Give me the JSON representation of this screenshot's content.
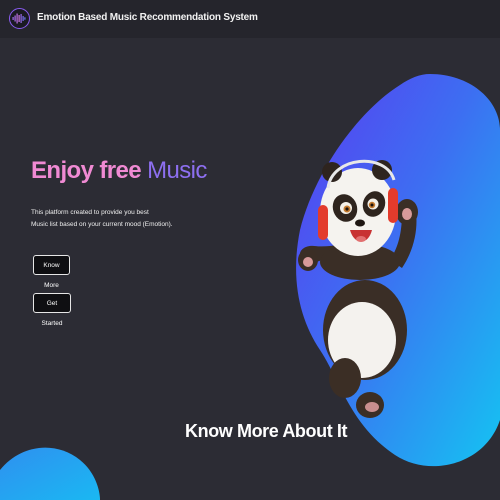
{
  "header": {
    "logo_icon": "sound-wave-icon",
    "title": "Emotion Based Music Recommendation System"
  },
  "hero": {
    "headline_part1": "Enjoy free",
    "headline_part2": "Music",
    "description_line1": "This platform created to provide you best",
    "description_line2": "Music list based on your current mood (Emotion).",
    "know_more_label": "Know More",
    "get_started_label": "Get Started",
    "illustration": "panda-with-headphones-illustration"
  },
  "section": {
    "title": "Know More About It"
  },
  "colors": {
    "background": "#2c2c34",
    "headline_pink": "#f08ad3",
    "headline_purple": "#8d6ff0",
    "blob_blue": "#3d7cf0",
    "blob_purple": "#6a3ef0",
    "blob_cyan": "#16c4f2"
  }
}
